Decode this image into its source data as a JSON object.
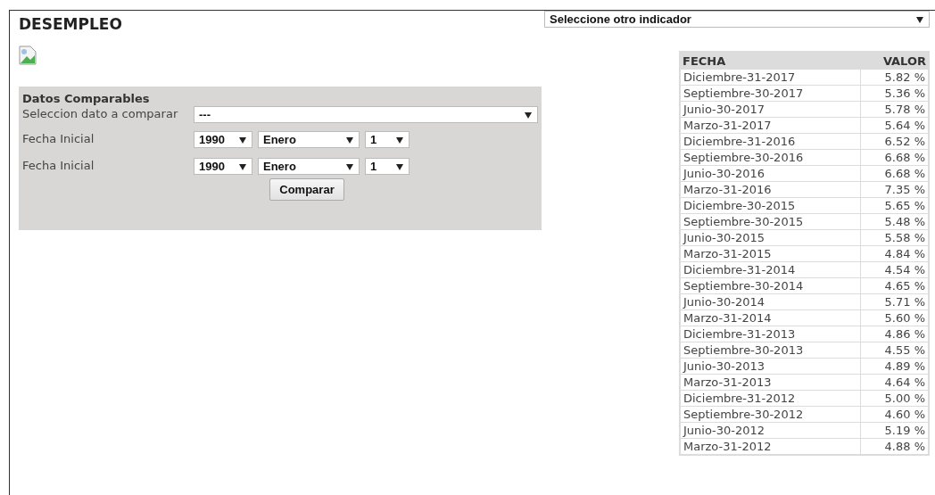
{
  "title": "DESEMPLEO",
  "indicator_select": {
    "value": "Seleccione otro indicador"
  },
  "compare_panel": {
    "heading": "Datos Comparables",
    "compare_field": {
      "label": "Seleccion dato a comparar",
      "value": "---"
    },
    "date_rows": [
      {
        "label": "Fecha Inicial",
        "year": "1990",
        "month": "Enero",
        "day": "1"
      },
      {
        "label": "Fecha Inicial",
        "year": "1990",
        "month": "Enero",
        "day": "1"
      }
    ],
    "button": "Comparar"
  },
  "table": {
    "columns": [
      "FECHA",
      "VALOR"
    ],
    "rows": [
      [
        "Diciembre-31-2017",
        "5.82 %"
      ],
      [
        "Septiembre-30-2017",
        "5.36 %"
      ],
      [
        "Junio-30-2017",
        "5.78 %"
      ],
      [
        "Marzo-31-2017",
        "5.64 %"
      ],
      [
        "Diciembre-31-2016",
        "6.52 %"
      ],
      [
        "Septiembre-30-2016",
        "6.68 %"
      ],
      [
        "Junio-30-2016",
        "6.68 %"
      ],
      [
        "Marzo-31-2016",
        "7.35 %"
      ],
      [
        "Diciembre-30-2015",
        "5.65 %"
      ],
      [
        "Septiembre-30-2015",
        "5.48 %"
      ],
      [
        "Junio-30-2015",
        "5.58 %"
      ],
      [
        "Marzo-31-2015",
        "4.84 %"
      ],
      [
        "Diciembre-31-2014",
        "4.54 %"
      ],
      [
        "Septiembre-30-2014",
        "4.65 %"
      ],
      [
        "Junio-30-2014",
        "5.71 %"
      ],
      [
        "Marzo-31-2014",
        "5.60 %"
      ],
      [
        "Diciembre-31-2013",
        "4.86 %"
      ],
      [
        "Septiembre-30-2013",
        "4.55 %"
      ],
      [
        "Junio-30-2013",
        "4.89 %"
      ],
      [
        "Marzo-31-2013",
        "4.64 %"
      ],
      [
        "Diciembre-31-2012",
        "5.00 %"
      ],
      [
        "Septiembre-30-2012",
        "4.60 %"
      ],
      [
        "Junio-30-2012",
        "5.19 %"
      ],
      [
        "Marzo-31-2012",
        "4.88 %"
      ]
    ]
  }
}
